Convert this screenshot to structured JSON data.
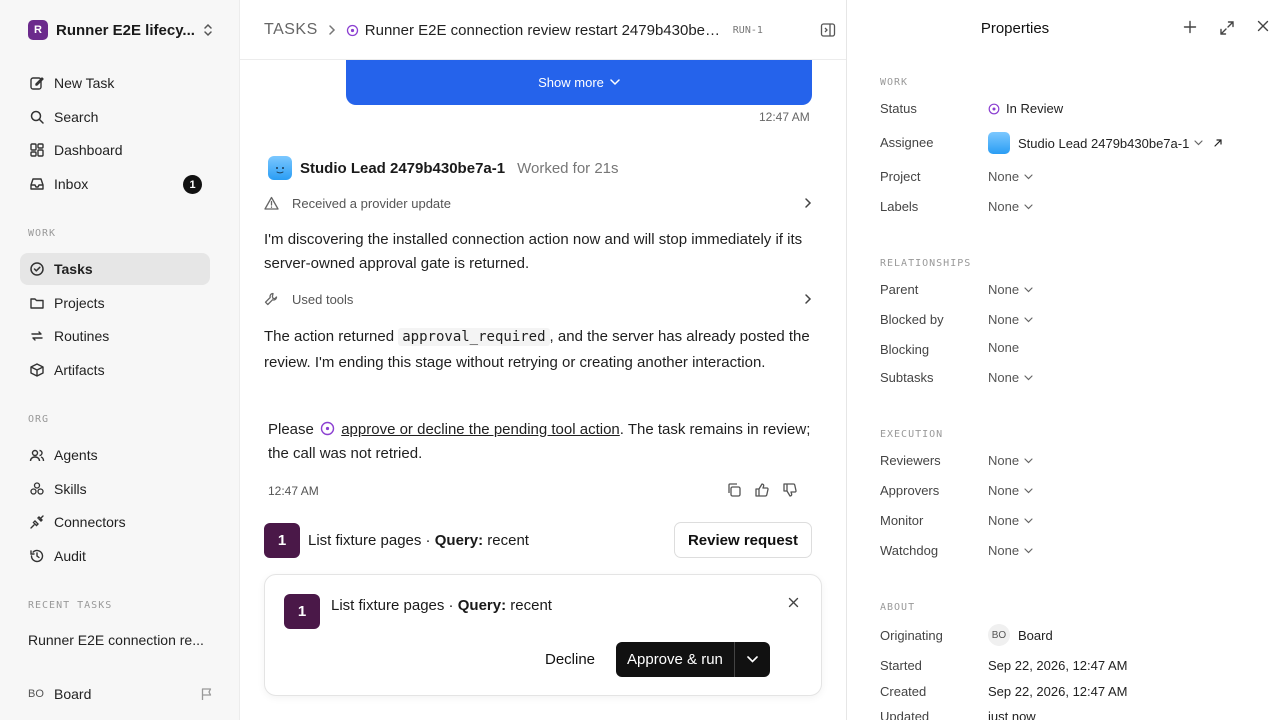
{
  "sidebar": {
    "workspace": {
      "logo": "R",
      "name": "Runner E2E lifecy..."
    },
    "top_items": [
      {
        "label": "New Task",
        "icon": "edit-icon"
      },
      {
        "label": "Search",
        "icon": "search-icon"
      },
      {
        "label": "Dashboard",
        "icon": "dashboard-icon"
      },
      {
        "label": "Inbox",
        "icon": "inbox-icon",
        "badge": "1"
      }
    ],
    "work_label": "WORK",
    "work_items": [
      {
        "label": "Tasks",
        "icon": "check-circle-icon",
        "active": true
      },
      {
        "label": "Projects",
        "icon": "folder-icon"
      },
      {
        "label": "Routines",
        "icon": "repeat-icon"
      },
      {
        "label": "Artifacts",
        "icon": "box-icon"
      }
    ],
    "org_label": "ORG",
    "org_items": [
      {
        "label": "Agents",
        "icon": "users-icon"
      },
      {
        "label": "Skills",
        "icon": "skills-icon"
      },
      {
        "label": "Connectors",
        "icon": "plug-icon"
      },
      {
        "label": "Audit",
        "icon": "history-icon"
      }
    ],
    "recent_label": "RECENT TASKS",
    "recent_items": [
      "Runner E2E connection re..."
    ],
    "footer": {
      "avatar": "BO",
      "name": "Board"
    }
  },
  "header": {
    "root": "TASKS",
    "title": "Runner E2E connection review restart 2479b430be7...",
    "run_tag": "RUN-1"
  },
  "thread": {
    "show_more": "Show more",
    "time_top": "12:47 AM",
    "agent_name": "Studio Lead 2479b430be7a-1",
    "agent_meta": "Worked for 21s",
    "event_provider": "Received a provider update",
    "para1": "I'm discovering the installed connection action now and will stop immediately if its server-owned approval gate is returned.",
    "event_tools": "Used tools",
    "para2_pre": "The action returned",
    "para2_code": "approval_required",
    "para2_post": ", and the server has already posted the review. I'm ending this stage without retrying or creating another interaction.",
    "para3_pre": "Please",
    "para3_link": "approve or decline the pending tool action",
    "para3_post": ". The task remains in review; the call was not retried.",
    "time_bottom": "12:47 AM"
  },
  "pending_action": {
    "number": "1",
    "text_pre": "List fixture pages · ",
    "query_label": "Query:",
    "query_value": "recent",
    "review_button": "Review request"
  },
  "approval": {
    "number": "1",
    "text_pre": "List fixture pages · ",
    "query_label": "Query:",
    "query_value": "recent",
    "decline": "Decline",
    "approve": "Approve & run"
  },
  "properties": {
    "title": "Properties",
    "work_label": "WORK",
    "status_label": "Status",
    "status_value": "In Review",
    "assignee_label": "Assignee",
    "assignee_value": "Studio Lead 2479b430be7a-1",
    "project_label": "Project",
    "project_value": "None",
    "labels_label": "Labels",
    "labels_value": "None",
    "relationships_label": "RELATIONSHIPS",
    "parent_label": "Parent",
    "parent_value": "None",
    "blocked_by_label": "Blocked by",
    "blocked_by_value": "None",
    "blocking_label": "Blocking",
    "blocking_value": "None",
    "subtasks_label": "Subtasks",
    "subtasks_value": "None",
    "execution_label": "EXECUTION",
    "reviewers_label": "Reviewers",
    "reviewers_value": "None",
    "approvers_label": "Approvers",
    "approvers_value": "None",
    "monitor_label": "Monitor",
    "monitor_value": "None",
    "watchdog_label": "Watchdog",
    "watchdog_value": "None",
    "about_label": "ABOUT",
    "originating_label": "Originating",
    "originating_avatar": "BO",
    "originating_value": "Board",
    "started_label": "Started",
    "started_value": "Sep 22, 2026, 12:47 AM",
    "created_label": "Created",
    "created_value": "Sep 22, 2026, 12:47 AM",
    "updated_label": "Updated",
    "updated_value": "just now"
  },
  "colors": {
    "accent_blue": "#2563eb",
    "status_purple": "#8b3fd1",
    "action_badge": "#4a1848",
    "primary_button": "#111111"
  }
}
